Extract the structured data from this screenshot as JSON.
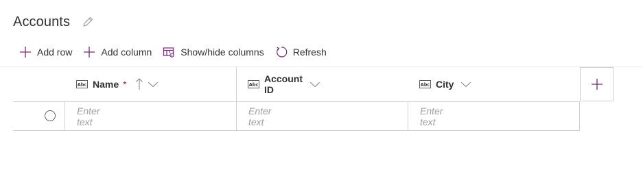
{
  "page": {
    "title": "Accounts"
  },
  "toolbar": {
    "add_row": "Add row",
    "add_column": "Add column",
    "show_hide": "Show/hide columns",
    "refresh": "Refresh"
  },
  "grid": {
    "columns": [
      {
        "label": "Name",
        "required": "*"
      },
      {
        "label": "Account ID"
      },
      {
        "label": "City"
      }
    ],
    "row": {
      "name_placeholder": "Enter text",
      "account_id_placeholder": "Enter text",
      "city_placeholder": "Enter text"
    }
  },
  "colors": {
    "accent": "#742774",
    "required": "#a4262c",
    "border": "#d2d0ce"
  },
  "icons": [
    "edit-icon",
    "add-icon",
    "add-icon",
    "show-hide-columns-icon",
    "refresh-icon",
    "text-field-icon",
    "sort-ascending-icon",
    "chevron-down-icon",
    "add-column-icon"
  ]
}
